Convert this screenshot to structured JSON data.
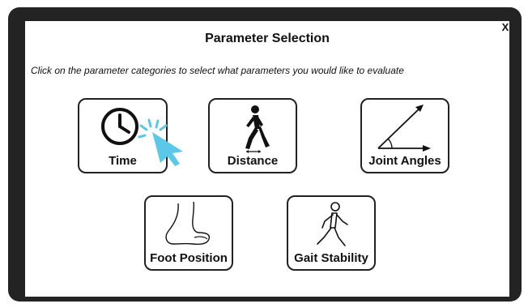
{
  "dialog": {
    "title": "Parameter Selection",
    "instruction": "Click on the parameter categories to select what parameters you would like to evaluate",
    "close_label": "X"
  },
  "categories": [
    {
      "label": "Time",
      "icon": "clock-icon",
      "hovered": true
    },
    {
      "label": "Distance",
      "icon": "walking-person-icon"
    },
    {
      "label": "Joint Angles",
      "icon": "angle-icon"
    },
    {
      "label": "Foot Position",
      "icon": "foot-icon"
    },
    {
      "label": "Gait Stability",
      "icon": "walking-stability-icon"
    }
  ],
  "colors": {
    "frame": "#232323",
    "cursor": "#5bc8e8",
    "text": "#111111"
  }
}
